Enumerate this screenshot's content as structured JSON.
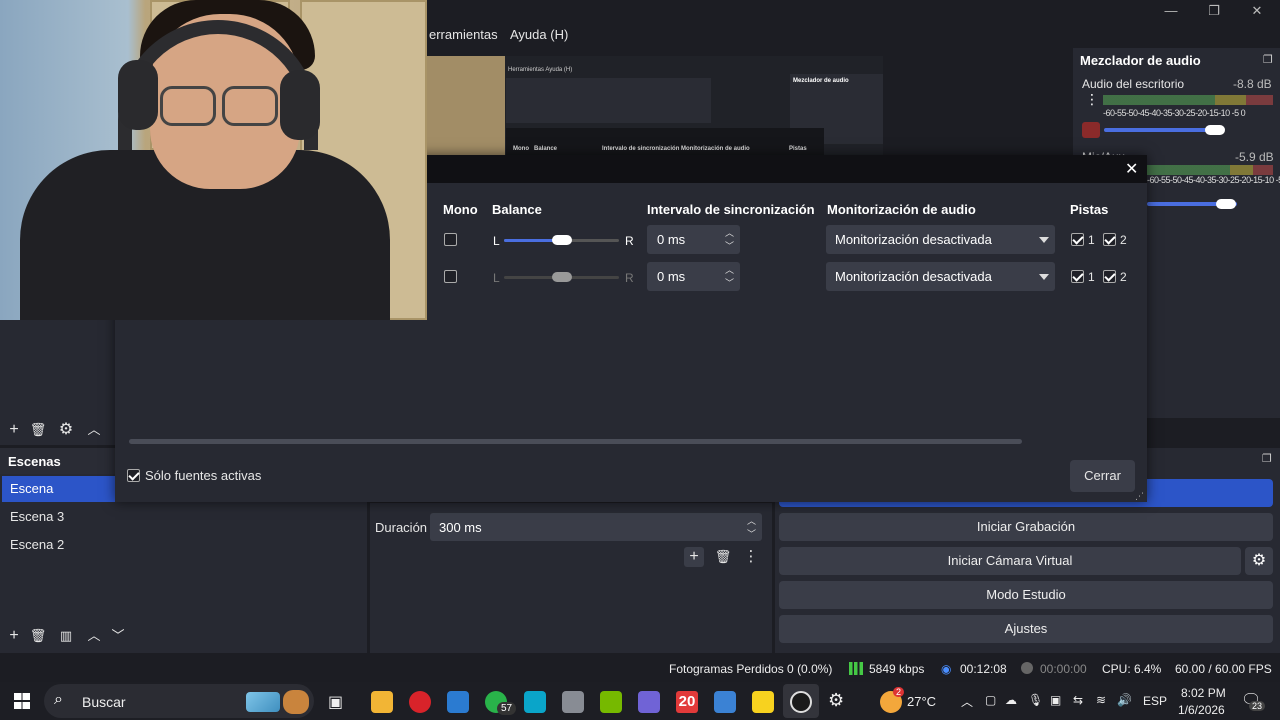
{
  "menu": {
    "tools": "erramientas",
    "help": "Ayuda (H)"
  },
  "window": {
    "minimize": "—",
    "restore": "❐",
    "close": "✕"
  },
  "mixer": {
    "title": "Mezclador de audio",
    "channels": [
      {
        "name": "Audio del escritorio",
        "db": "-8.8 dB",
        "volume": 0.68
      },
      {
        "name": "Mic/Aux",
        "db": "-5.9 dB",
        "volume": 0.72
      }
    ],
    "ticks": "-60-55-50-45-40-35-30-25-20-15-10 -5  0"
  },
  "preview": {
    "menu": "Herramientas  Ayuda (H)",
    "mixer_title": "Mezclador de audio",
    "cols": [
      "Mono",
      "Balance",
      "Intervalo de sincronización",
      "Monitorización de audio",
      "Pistas"
    ]
  },
  "dialog": {
    "columns": {
      "mono": "Mono",
      "balance": "Balance",
      "sync": "Intervalo de sincronización",
      "monitoring": "Monitorización de audio",
      "tracks": "Pistas"
    },
    "rows": [
      {
        "mono": false,
        "balance": 0.5,
        "left": "L",
        "right": "R",
        "sync": "0 ms",
        "monitoring": "Monitorización desactivada",
        "track1": "1",
        "track2": "2",
        "active": true
      },
      {
        "mono": false,
        "balance": 0.5,
        "left": "L",
        "right": "R",
        "sync": "0 ms",
        "monitoring": "Monitorización desactivada",
        "track1": "1",
        "track2": "2",
        "active": false
      }
    ],
    "only_active_label": "Sólo fuentes activas",
    "only_active": true,
    "close_button": "Cerrar"
  },
  "scenes": {
    "title": "Escenas",
    "items": [
      "Escena",
      "Escena 3",
      "Escena 2"
    ],
    "selected": 0
  },
  "transitions": {
    "duration_label": "Duración",
    "duration_value": "300 ms"
  },
  "controls": {
    "start_recording": "Iniciar Grabación",
    "start_virtual_cam": "Iniciar Cámara Virtual",
    "studio_mode": "Modo Estudio",
    "settings": "Ajustes"
  },
  "status": {
    "dropped_frames": "Fotogramas Perdidos 0 (0.0%)",
    "bitrate": "5849 kbps",
    "stream_time": "00:12:08",
    "rec_time": "00:00:00",
    "cpu": "CPU: 6.4%",
    "fps": "60.00 / 60.00 FPS"
  },
  "taskbar": {
    "search": "Buscar",
    "whatsapp_badge": "57",
    "app_20": "20",
    "weather": "27°C",
    "weather_badge": "2",
    "language": "ESP",
    "time": "8:02 PM",
    "date": "1/6/2026",
    "notifications": "23"
  },
  "colors": {
    "accent": "#2c55c8",
    "panel": "#272932",
    "background": "#1c1d23",
    "dialog_titlebar": "#101014"
  }
}
